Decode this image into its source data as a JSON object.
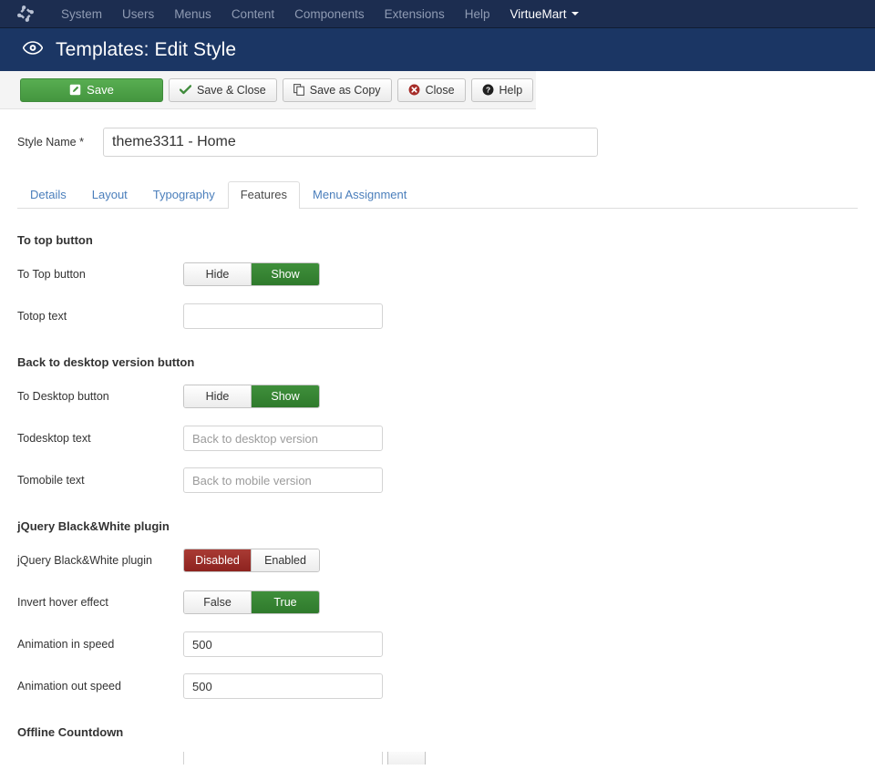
{
  "admin_nav": {
    "logo_icon": "joomla-logo-icon",
    "items": [
      {
        "label": "System",
        "has_caret": false,
        "bright": false
      },
      {
        "label": "Users",
        "has_caret": false,
        "bright": false
      },
      {
        "label": "Menus",
        "has_caret": false,
        "bright": false
      },
      {
        "label": "Content",
        "has_caret": false,
        "bright": false
      },
      {
        "label": "Components",
        "has_caret": false,
        "bright": false
      },
      {
        "label": "Extensions",
        "has_caret": false,
        "bright": false
      },
      {
        "label": "Help",
        "has_caret": false,
        "bright": false
      },
      {
        "label": "VirtueMart",
        "has_caret": true,
        "bright": true
      }
    ]
  },
  "page_header": {
    "icon": "eye-icon",
    "title": "Templates: Edit Style",
    "background_color": "#1b3664"
  },
  "toolbar": {
    "buttons": [
      {
        "label": "Save",
        "icon": "edit-square-icon",
        "style": "primary",
        "accent": "#44963f"
      },
      {
        "label": "Save & Close",
        "icon": "check-icon",
        "style": "default",
        "accent": "#3f8b3b"
      },
      {
        "label": "Save as Copy",
        "icon": "copy-icon",
        "style": "default",
        "accent": "#555555"
      },
      {
        "label": "Close",
        "icon": "close-circle-icon",
        "style": "default",
        "accent": "#a62c28"
      },
      {
        "label": "Help",
        "icon": "question-circle-icon",
        "style": "default",
        "accent": "#222222"
      }
    ]
  },
  "style_name": {
    "label": "Style Name *",
    "value": "theme3311 - Home",
    "placeholder": ""
  },
  "tabs": [
    {
      "label": "Details",
      "active": false
    },
    {
      "label": "Layout",
      "active": false
    },
    {
      "label": "Typography",
      "active": false
    },
    {
      "label": "Features",
      "active": true
    },
    {
      "label": "Menu Assignment",
      "active": false
    }
  ],
  "groups": {
    "to_top": {
      "title": "To top button",
      "to_top_button": {
        "label": "To Top button",
        "options": [
          "Hide",
          "Show"
        ],
        "selected": "Show",
        "selected_color": "#2f7a2c"
      },
      "totop_text": {
        "label": "Totop text",
        "value": "",
        "placeholder": ""
      }
    },
    "to_desktop": {
      "title": "Back to desktop version button",
      "to_desktop_button": {
        "label": "To Desktop button",
        "options": [
          "Hide",
          "Show"
        ],
        "selected": "Show",
        "selected_color": "#2f7a2c"
      },
      "todesktop_text": {
        "label": "Todesktop text",
        "value": "",
        "placeholder": "Back to desktop version"
      },
      "tomobile_text": {
        "label": "Tomobile text",
        "value": "",
        "placeholder": "Back to mobile version"
      }
    },
    "blackwhite": {
      "title": "jQuery Black&White plugin",
      "plugin_toggle": {
        "label": "jQuery Black&White plugin",
        "options": [
          "Disabled",
          "Enabled"
        ],
        "selected": "Disabled",
        "selected_color": "#8d231f"
      },
      "invert_hover": {
        "label": "Invert hover effect",
        "options": [
          "False",
          "True"
        ],
        "selected": "True",
        "selected_color": "#2f7a2c"
      },
      "animation_in": {
        "label": "Animation in speed",
        "value": "500",
        "placeholder": ""
      },
      "animation_out": {
        "label": "Animation out speed",
        "value": "500",
        "placeholder": ""
      }
    },
    "offline_countdown": {
      "title": "Offline Countdown"
    }
  }
}
